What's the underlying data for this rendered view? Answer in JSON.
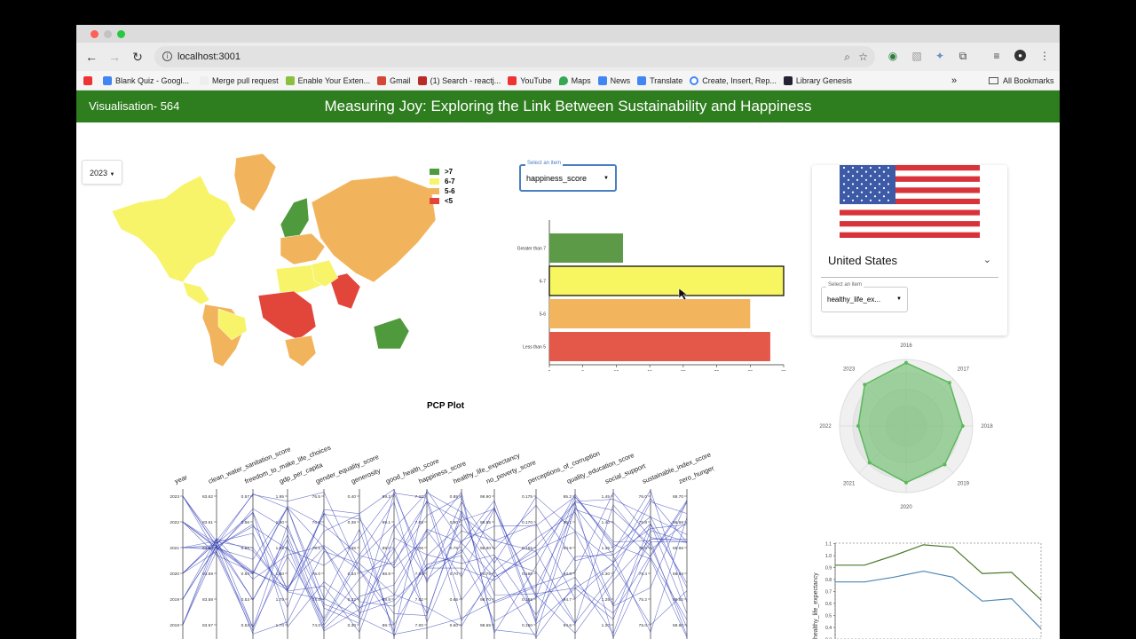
{
  "browser": {
    "url": "localhost:3001",
    "bookmarks": [
      "Blank Quiz - Googl...",
      "Merge pull request",
      "Enable Your Exten...",
      "Gmail",
      "(1) Search - reactj...",
      "YouTube",
      "Maps",
      "News",
      "Translate",
      "Create, Insert, Rep...",
      "Library Genesis"
    ],
    "all_bookmarks": "All Bookmarks",
    "overflow": "»"
  },
  "app": {
    "left_label": "Visualisation- 564",
    "title": "Measuring Joy: Exploring the Link Between Sustainability and Happiness",
    "year_select": "2023",
    "brand_color": "#2e7d1e"
  },
  "map_legend": [
    {
      "label": ">7",
      "color": "#4e9a3c"
    },
    {
      "label": "6-7",
      "color": "#f7f46a"
    },
    {
      "label": "5-6",
      "color": "#f1b45c"
    },
    {
      "label": "<5",
      "color": "#e2463b"
    }
  ],
  "bar_select": {
    "label": "Select an item",
    "value": "happiness_score"
  },
  "side_card": {
    "country": "United States",
    "select_label": "Select an item",
    "select_value": "healthy_life_ex..."
  },
  "pcp_title": "PCP Plot",
  "pcp_axes": [
    "year",
    "clean_water_sanitation_score",
    "freedom_to_make_life_choices",
    "gdp_per_capita",
    "gender_equality_score",
    "generosity",
    "good_health_score",
    "happiness_score",
    "healthy_life_expectancy",
    "no_poverty_score",
    "perceptions_of_corruption",
    "quality_education_score",
    "social_support",
    "sustainable_index_score",
    "zero_hunger_score"
  ],
  "pcp_ticks": [
    [
      "2023",
      "2022",
      "2021",
      "2020",
      "2019",
      "2018"
    ],
    [
      "83.62",
      "83.61",
      "83.60",
      "83.59",
      "83.58",
      "83.57",
      "83.56",
      "83.55",
      "83.54"
    ],
    [
      "0.57",
      "0.56",
      "0.55",
      "0.54",
      "0.53",
      "0.52",
      "0.51",
      "0.50",
      "0.49"
    ],
    [
      "1.95",
      "1.90",
      "1.85",
      "1.80",
      "1.75",
      "1.70",
      "1.65",
      "1.60"
    ],
    [
      "76.5",
      "76.0",
      "75.5",
      "75.0",
      "74.5",
      "74.0",
      "73.5",
      "73.0"
    ],
    [
      "0.40",
      "0.38",
      "0.36",
      "0.34",
      "0.32",
      "0.30",
      "0.28"
    ],
    [
      "89.2",
      "89.1",
      "89.0",
      "88.9",
      "88.8",
      "88.7",
      "88.6"
    ],
    [
      "7.10",
      "7.08",
      "7.06",
      "7.04",
      "7.02",
      "7.00",
      "6.98",
      "6.96"
    ],
    [
      "0.85",
      "0.80",
      "0.75",
      "0.70",
      "0.65",
      "0.60",
      "0.55"
    ],
    [
      "98.90",
      "98.85",
      "98.80",
      "98.75",
      "98.70",
      "98.65",
      "98.60"
    ],
    [
      "0.175",
      "0.170",
      "0.165",
      "0.160",
      "0.155",
      "0.150",
      "0.145"
    ],
    [
      "95.2",
      "95.1",
      "94.9",
      "94.8",
      "94.7",
      "94.6",
      "94.5",
      "94.4"
    ],
    [
      "1.45",
      "1.40",
      "1.35",
      "1.30",
      "1.25",
      "1.20",
      "1.15"
    ],
    [
      "76.0",
      "75.8",
      "75.6",
      "75.4",
      "75.2",
      "75.0",
      "74.8"
    ],
    [
      "68.70",
      "68.68",
      "68.66",
      "68.64",
      "68.62",
      "68.60",
      "68.58",
      "68.56"
    ]
  ],
  "chart_data": [
    {
      "type": "bar",
      "orientation": "horizontal",
      "categories": [
        "Greater than 7",
        "6-7",
        "5-6",
        "Less than 5"
      ],
      "values": [
        11,
        35,
        30,
        33
      ],
      "colors": [
        "#5c9a48",
        "#f7f560",
        "#f2b55e",
        "#e4584a"
      ],
      "xticks": [
        "0",
        "5",
        "10",
        "15",
        "20",
        "25",
        "30",
        "35"
      ],
      "xlim": [
        0,
        35
      ]
    },
    {
      "type": "radar",
      "categories": [
        "2018",
        "2019",
        "2020",
        "2021",
        "2022",
        "2023",
        "2018"
      ],
      "years": [
        "2016",
        "2017",
        "2018",
        "2019",
        "2020",
        "2021",
        "2022",
        "2023"
      ],
      "values": [
        0.95,
        0.92,
        0.85,
        0.82,
        0.85,
        0.78,
        0.72,
        0.88
      ],
      "color": "#5cb85c"
    },
    {
      "type": "line",
      "ylabel": "healthy_life_expectancy",
      "yticks": [
        "1.1",
        "1.0",
        "0.9",
        "0.8",
        "0.7",
        "0.6",
        "0.5",
        "0.4",
        "0.3"
      ],
      "series": [
        {
          "values": [
            0.92,
            0.92,
            1.0,
            1.09,
            1.07,
            0.85,
            0.86,
            0.63
          ],
          "color": "#4c7a2a"
        },
        {
          "values": [
            0.78,
            0.78,
            0.82,
            0.87,
            0.82,
            0.62,
            0.64,
            0.39
          ],
          "color": "#4d86b5"
        }
      ]
    }
  ]
}
